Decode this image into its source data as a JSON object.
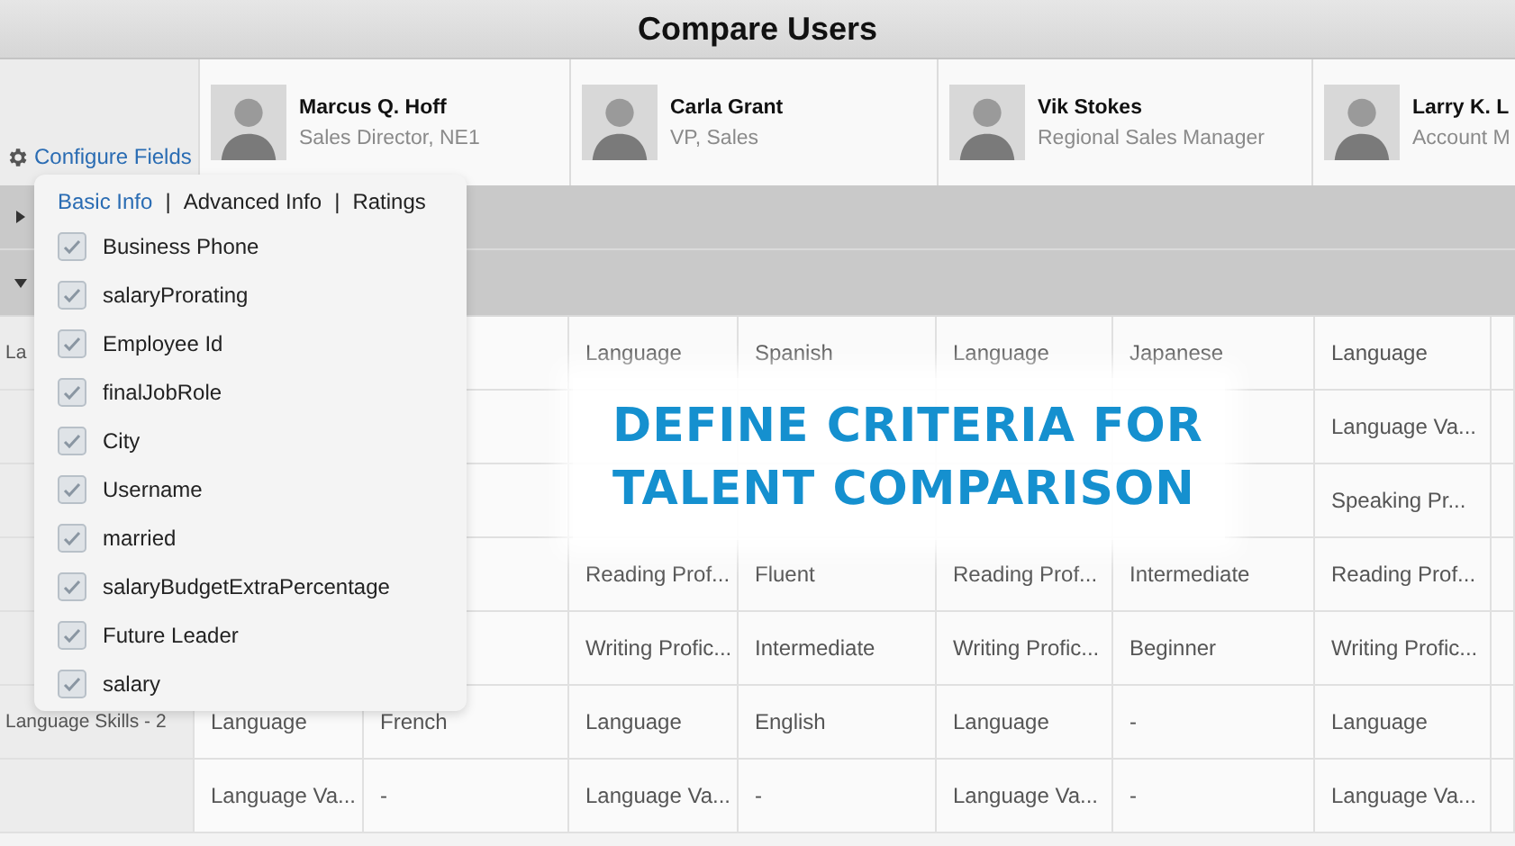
{
  "title": "Compare Users",
  "configure_link": "Configure Fields",
  "users": [
    {
      "name": "Marcus Q. Hoff",
      "role": "Sales Director, NE1"
    },
    {
      "name": "Carla Grant",
      "role": "VP, Sales"
    },
    {
      "name": "Vik Stokes",
      "role": "Regional Sales Manager"
    },
    {
      "name": "Larry K. L",
      "role": "Account M"
    }
  ],
  "group_rows": [
    {
      "expanded": false
    },
    {
      "expanded": true
    }
  ],
  "table": {
    "rows": [
      {
        "label": "La",
        "cells": [
          null,
          null,
          "Language",
          "Spanish",
          "Language",
          "Japanese",
          "Language",
          null
        ]
      },
      {
        "label": null,
        "cells": [
          null,
          null,
          null,
          null,
          null,
          null,
          "Language Va...",
          null
        ]
      },
      {
        "label": null,
        "cells": [
          null,
          null,
          null,
          null,
          null,
          null,
          "Speaking Pr...",
          null
        ]
      },
      {
        "label": null,
        "cells": [
          null,
          null,
          "Reading Prof...",
          "Fluent",
          "Reading Prof...",
          "Intermediate",
          "Reading Prof...",
          null
        ]
      },
      {
        "label": null,
        "cells": [
          null,
          null,
          "Writing Profic...",
          "Intermediate",
          "Writing Profic...",
          "Beginner",
          "Writing Profic...",
          null
        ]
      },
      {
        "label": "Language Skills - 2",
        "cells": [
          "Language",
          "French",
          "Language",
          "English",
          "Language",
          "-",
          "Language",
          null
        ]
      },
      {
        "label": null,
        "cells": [
          "Language Va...",
          "-",
          "Language Va...",
          "-",
          "Language Va...",
          "-",
          "Language Va...",
          null
        ]
      }
    ]
  },
  "field_picker": {
    "separators": [
      "|",
      "|"
    ],
    "tabs": [
      {
        "label": "Basic Info",
        "selected": true
      },
      {
        "label": "Advanced Info",
        "selected": false
      },
      {
        "label": "Ratings",
        "selected": false
      }
    ],
    "fields": [
      {
        "label": "Business Phone",
        "checked": true
      },
      {
        "label": "salaryProrating",
        "checked": true
      },
      {
        "label": "Employee Id",
        "checked": true
      },
      {
        "label": "finalJobRole",
        "checked": true
      },
      {
        "label": "City",
        "checked": true
      },
      {
        "label": "Username",
        "checked": true
      },
      {
        "label": "married",
        "checked": true
      },
      {
        "label": "salaryBudgetExtraPercentage",
        "checked": true
      },
      {
        "label": "Future Leader",
        "checked": true
      },
      {
        "label": "salary",
        "checked": true
      }
    ]
  },
  "caption": "DEFINE CRITERIA FOR TALENT COMPARISON"
}
